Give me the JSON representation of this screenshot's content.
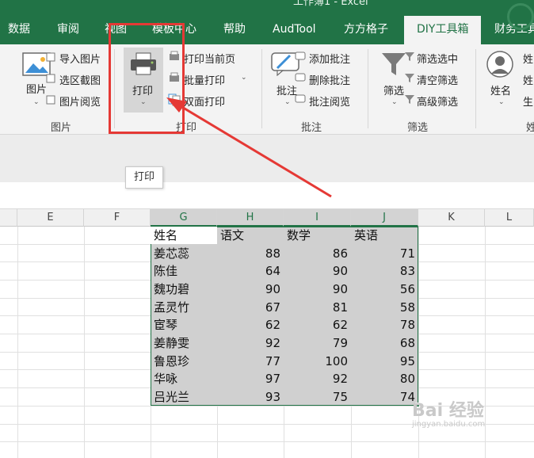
{
  "title": "工作簿1 - Excel",
  "tabs": [
    {
      "label": "数据",
      "active": false
    },
    {
      "label": "审阅",
      "active": false
    },
    {
      "label": "视图",
      "active": false
    },
    {
      "label": "模板中心",
      "active": false
    },
    {
      "label": "帮助",
      "active": false
    },
    {
      "label": "AudTool",
      "active": false
    },
    {
      "label": "方方格子",
      "active": false
    },
    {
      "label": "DIY工具箱",
      "active": true
    },
    {
      "label": "财务工具",
      "active": false
    }
  ],
  "ribbon": {
    "picture_group": {
      "big_button": "图片",
      "items": [
        "导入图片",
        "选区截图",
        "图片阅览"
      ],
      "group_label": "图片"
    },
    "print_group": {
      "big_button": "打印",
      "items": [
        "打印当前页",
        "批量打印",
        "双面打印"
      ],
      "group_label": "打印"
    },
    "comment_group": {
      "big_button": "批注",
      "items": [
        "添加批注",
        "删除批注",
        "批注阅览"
      ],
      "group_label": "批注"
    },
    "filter_group": {
      "big_button": "筛选",
      "items": [
        "筛选选中",
        "清空筛选",
        "高级筛选"
      ],
      "group_label": "筛选"
    },
    "name_group": {
      "big_button": "姓名",
      "items": [
        "姓",
        "姓",
        "生"
      ],
      "group_label": "姓"
    }
  },
  "tooltip": "打印",
  "sheet": {
    "columns": [
      "E",
      "F",
      "G",
      "H",
      "I",
      "J",
      "K",
      "L"
    ],
    "headers": [
      "姓名",
      "语文",
      "数学",
      "英语"
    ],
    "rows": [
      {
        "name": "姜芯蕊",
        "chinese": "88",
        "math": "86",
        "english": "71"
      },
      {
        "name": "陈佳",
        "chinese": "64",
        "math": "90",
        "english": "83"
      },
      {
        "name": "魏功碧",
        "chinese": "90",
        "math": "90",
        "english": "56"
      },
      {
        "name": "孟灵竹",
        "chinese": "67",
        "math": "81",
        "english": "58"
      },
      {
        "name": "宦琴",
        "chinese": "62",
        "math": "62",
        "english": "78"
      },
      {
        "name": "姜静雯",
        "chinese": "92",
        "math": "79",
        "english": "68"
      },
      {
        "name": "鲁恩珍",
        "chinese": "77",
        "math": "100",
        "english": "95"
      },
      {
        "name": "华咏",
        "chinese": "97",
        "math": "92",
        "english": "80"
      },
      {
        "name": "吕光兰",
        "chinese": "93",
        "math": "75",
        "english": "74"
      }
    ]
  },
  "watermark": {
    "main": "Bai 经验",
    "sub": "jingyan.baidu.com"
  },
  "colors": {
    "accent": "#217346",
    "highlight": "#e53935"
  }
}
